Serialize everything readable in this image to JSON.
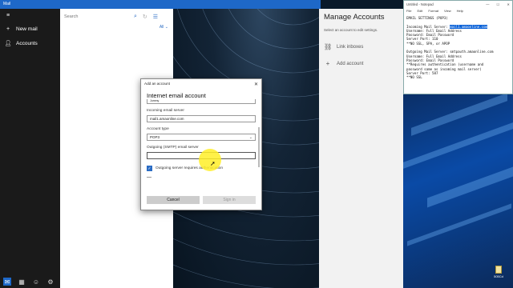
{
  "mail": {
    "title": "Mail",
    "new_mail": "New mail",
    "accounts": "Accounts",
    "search_placeholder": "Search",
    "filter": "All"
  },
  "manage": {
    "title": "Manage Accounts",
    "subtitle": "Select an account to edit settings.",
    "link_inboxes": "Link inboxes",
    "add_account": "Add account"
  },
  "notepad": {
    "title": "Untitled - Notepad",
    "menu": [
      "File",
      "Edit",
      "Format",
      "View",
      "Help"
    ],
    "body_before": "EMAIL SETTINGS (POP3)\n\nIncoming Mail Server: ",
    "highlight": "mail1.amaonline.com",
    "body_after": "\nUsername: Full Email Address\nPassword: Email Password\nServer Port: 110\n**NO SSL, SPA, or APOP\n\nOutgoing Mail Server: smtpauth.amaonline.com\nUsername: Full Email Address\nPassword: Email Password\n**Requires authentication (username and\npassword same as incoming mail server)\nServer Port: 587\n**NO SSL"
  },
  "dialog": {
    "title": "Add an account",
    "heading": "Internet email account",
    "partial_value": "Jummy",
    "incoming_label": "Incoming email server",
    "incoming_value": "mail1.amaonline.com",
    "type_label": "Account type",
    "type_value": "POP3",
    "outgoing_label": "Outgoing (SMTP) email server",
    "outgoing_value": "",
    "auth_label": "Outgoing server requires authentication",
    "cancel": "Cancel",
    "signin": "Sign in"
  },
  "desktop": {
    "file_label": "505Cd"
  },
  "colors": {
    "accent": "#1e68c8",
    "highlight": "#0b62d8",
    "cursor_spot": "#ffee28"
  }
}
